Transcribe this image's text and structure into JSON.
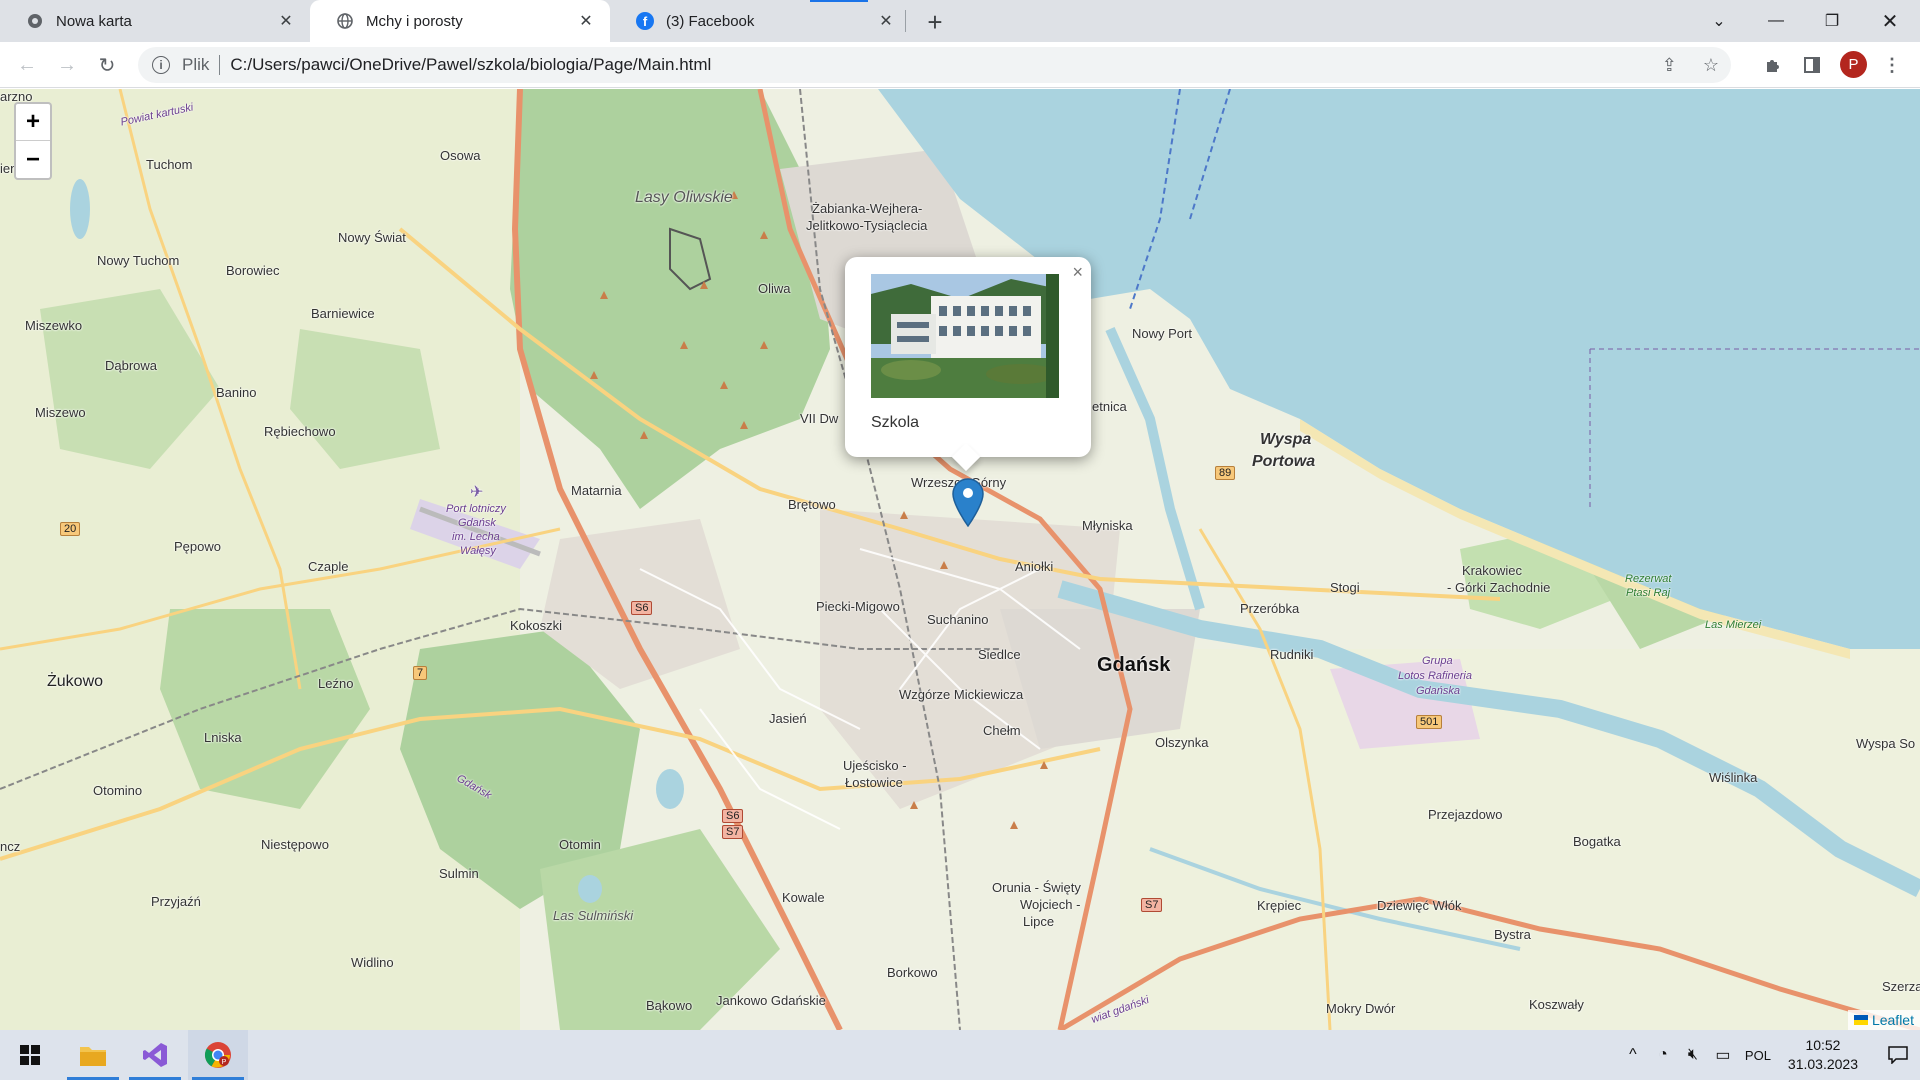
{
  "browser": {
    "tabs": [
      {
        "title": "Nowa karta",
        "active": false
      },
      {
        "title": "Mchy i porosty",
        "active": true
      },
      {
        "title": "(3) Facebook",
        "active": false
      }
    ],
    "address": {
      "scheme": "Plik",
      "url": "C:/Users/pawci/OneDrive/Pawel/szkola/biologia/Page/Main.html"
    },
    "profile_initial": "P"
  },
  "map": {
    "zoom_in": "+",
    "zoom_out": "−",
    "popup": {
      "caption": "Szkola",
      "close": "×"
    },
    "attribution": "Leaflet",
    "places": {
      "gdansk": "Gdańsk",
      "zukowo": "Żukowo",
      "wyspa_portowa_1": "Wyspa",
      "wyspa_portowa_2": "Portowa",
      "lasy_oliwskie": "Lasy Oliwskie",
      "osowa": "Osowa",
      "tuchom": "Tuchom",
      "nowy_tuchom": "Nowy Tuchom",
      "nowy_swiat": "Nowy Świat",
      "borowiec": "Borowiec",
      "barniewice": "Barniewice",
      "miszewko": "Miszewko",
      "dabrowa": "Dąbrowa",
      "banino": "Banino",
      "miszewo": "Miszewo",
      "rebiechowo": "Rębiechowo",
      "matarnia": "Matarnia",
      "bretowo": "Brętowo",
      "oliwa": "Oliwa",
      "zabianka_1": "Żabianka-Wejhera-",
      "zabianka_2": "Jelitkowo-Tysiąclecia",
      "nowy_port": "Nowy Port",
      "letnica": "etnica",
      "vii_dwor": "VII Dw",
      "wrzeszcz": "Wrzeszcz Górny",
      "mlyniska": "Młyniska",
      "aniolki": "Aniołki",
      "piecki": "Piecki-Migowo",
      "suchanino": "Suchanino",
      "siedlce": "Siedlce",
      "przerobka": "Przeróbka",
      "stogi": "Stogi",
      "krakowiec_1": "Krakowiec",
      "krakowiec_2": "- Górki Zachodnie",
      "rudniki": "Rudniki",
      "kokoszki": "Kokoszki",
      "pepowo": "Pępowo",
      "czaple": "Czaple",
      "lezno": "Leźno",
      "lniska": "Lniska",
      "jasien": "Jasień",
      "wzgorze": "Wzgórze Mickiewicza",
      "chelm": "Chełm",
      "olszynka": "Olszynka",
      "ujescisko_1": "Ujeścisko -",
      "ujescisko_2": "Łostowice",
      "otomino": "Otomino",
      "niestepowo": "Niestępowo",
      "otomin": "Otomin",
      "sulmin": "Sulmin",
      "przyjazn": "Przyjaźń",
      "las_sulminski": "Las Sulmiński",
      "kowale": "Kowale",
      "orunia_1": "Orunia - Święty",
      "orunia_2": "Wojciech -",
      "orunia_3": "Lipce",
      "krepiec": "Krępiec",
      "dziewiec_wlok": "Dziewięć Włók",
      "bystra": "Bystra",
      "przejazdowo": "Przejazdowo",
      "bogatka": "Bogatka",
      "wislinka": "Wiślinka",
      "wyspa_so": "Wyspa So",
      "widlino": "Widlino",
      "borkowo": "Borkowo",
      "bakowo": "Bąkowo",
      "jankowo": "Jankowo Gdańskie",
      "mokry_dwor": "Mokry Dwór",
      "koszwaly": "Koszwały",
      "szerzaw": "Szerzaw",
      "lotnisko_1": "Port lotniczy",
      "lotnisko_2": "Gdańsk",
      "lotnisko_3": "im. Lecha",
      "lotnisko_4": "Wałęsy",
      "grupa_1": "Grupa",
      "grupa_2": "Lotos Rafineria",
      "grupa_3": "Gdańska",
      "rezerwat_1": "Rezerwat",
      "rezerwat_2": "Ptasi Raj",
      "las_mierzei": "Las Mierzei",
      "powiat_kartuski": "Powiat kartuski",
      "gdansk_small": "Gdańsk",
      "zarno": "arzno",
      "nienko": "ienko",
      "ncz": "ncz",
      "gdanski": "wiat gdański"
    },
    "shields": {
      "s6": "S6",
      "s6s7_1": "S6",
      "s6s7_2": "S7",
      "s7": "S7",
      "r89": "89",
      "r20": "20",
      "r7": "7",
      "r501": "501"
    }
  },
  "taskbar": {
    "language": "POL",
    "time": "10:52",
    "date": "31.03.2023"
  },
  "colors": {
    "sea": "#aad3df",
    "forest": "#add19e",
    "land": "#f2efe9",
    "marker": "#2a81cb",
    "road_major": "#e8926b",
    "road_minor": "#f9d380"
  }
}
